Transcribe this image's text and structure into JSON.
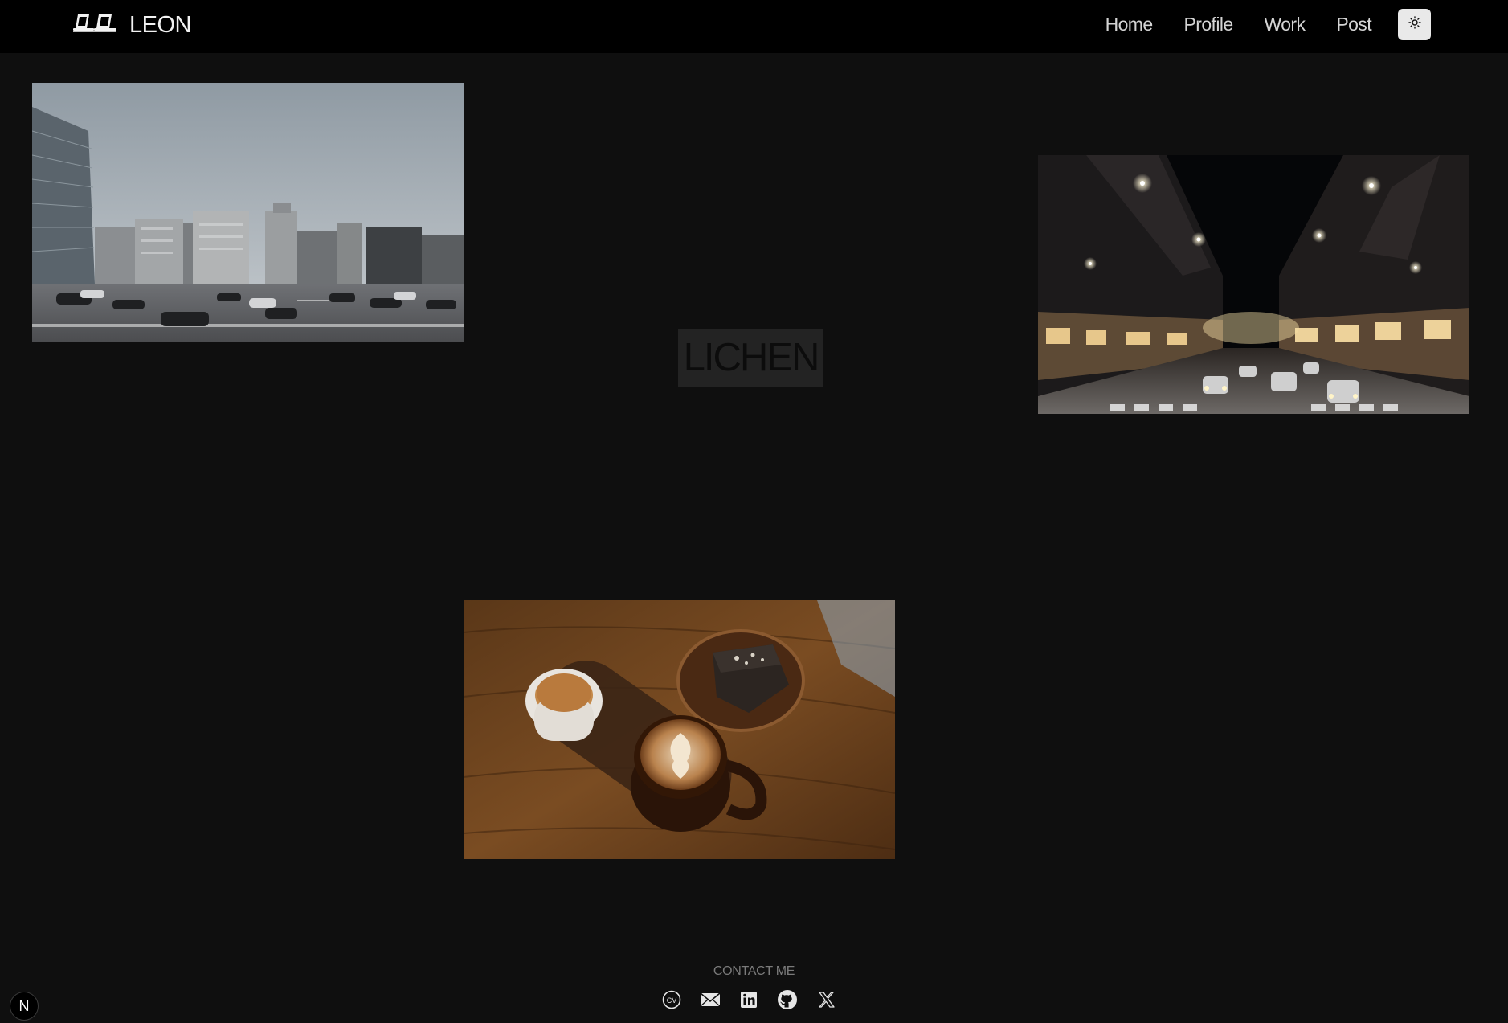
{
  "header": {
    "brand_name": "LEON",
    "nav": [
      "Home",
      "Profile",
      "Work",
      "Post"
    ],
    "theme_toggle_icon": "sun-icon"
  },
  "main": {
    "center_label": "LICHEN",
    "photos": [
      {
        "name": "photo-city-intersection",
        "subject": "city-intersection"
      },
      {
        "name": "photo-night-street",
        "subject": "night-street"
      },
      {
        "name": "photo-coffee-dessert",
        "subject": "coffee-and-cake"
      }
    ]
  },
  "footer": {
    "contact_label": "CONTACT ME",
    "socials": [
      "cv-icon",
      "mail-icon",
      "linkedin-icon",
      "github-icon",
      "x-icon"
    ]
  },
  "dev_badge": {
    "label": "N"
  },
  "colors": {
    "page_bg": "#0f0f0f",
    "header_bg": "#000000",
    "nav_text": "#d4d4d4",
    "muted": "#7a7a7a"
  }
}
